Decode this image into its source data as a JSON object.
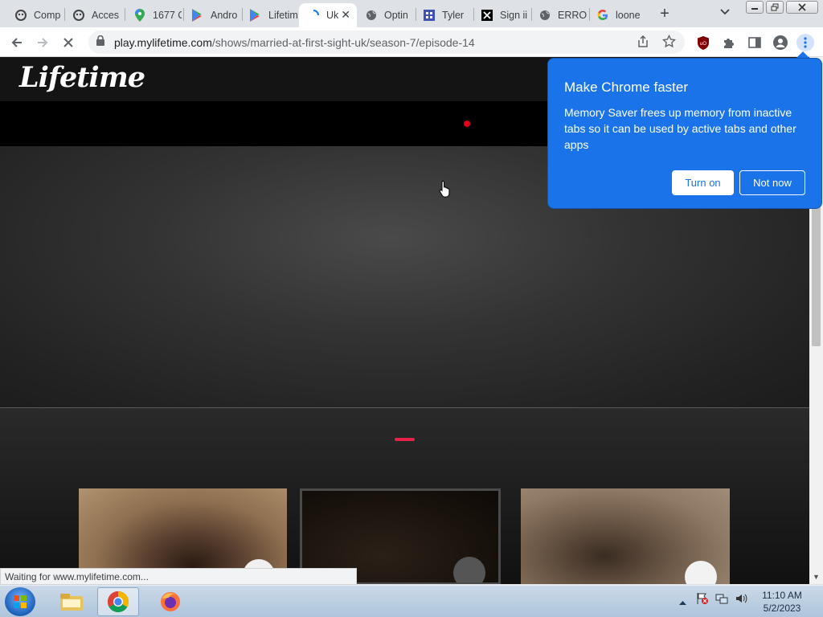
{
  "browser": {
    "tabs": [
      {
        "title": "Comp",
        "icon": "robot-icon"
      },
      {
        "title": "Acces",
        "icon": "robot-icon"
      },
      {
        "title": "1677 C",
        "icon": "maps-pin-icon"
      },
      {
        "title": "Andro",
        "icon": "play-store-icon"
      },
      {
        "title": "Lifetim",
        "icon": "play-store-icon"
      },
      {
        "title": "Uk",
        "icon": "loading-spinner-icon",
        "active": true
      },
      {
        "title": "Optin",
        "icon": "globe-icon"
      },
      {
        "title": "Tyler",
        "icon": "grid-icon"
      },
      {
        "title": "Sign ii",
        "icon": "x-logo-icon"
      },
      {
        "title": "ERRO",
        "icon": "globe-icon"
      },
      {
        "title": "loone",
        "icon": "google-icon"
      }
    ],
    "url_host": "play.mylifetime.com",
    "url_path": "/shows/married-at-first-sight-uk/season-7/episode-14",
    "status_text": "Waiting for www.mylifetime.com..."
  },
  "site": {
    "logo": "Lifetime"
  },
  "popup": {
    "title": "Make Chrome faster",
    "body": "Memory Saver frees up memory from inactive tabs so it can be used by active tabs and other apps",
    "primary_label": "Turn on",
    "secondary_label": "Not now"
  },
  "taskbar": {
    "time": "11:10 AM",
    "date": "5/2/2023"
  }
}
